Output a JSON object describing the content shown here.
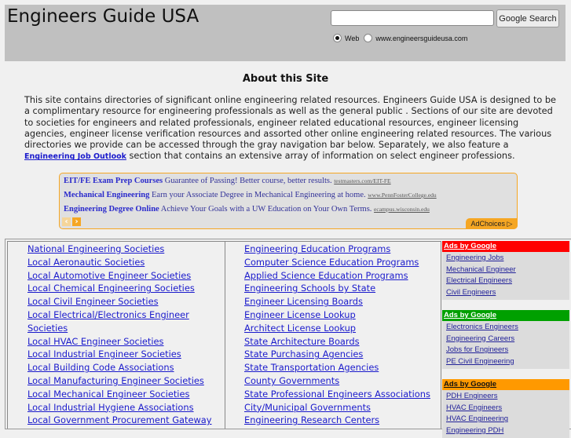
{
  "header": {
    "site_title": "Engineers Guide USA",
    "search": {
      "placeholder": "",
      "value": "",
      "button_label": "Google Search",
      "options": [
        {
          "label": "Web",
          "checked": true
        },
        {
          "label": "www.engineersguideusa.com",
          "checked": false
        }
      ]
    }
  },
  "about": {
    "title": "About this Site",
    "text_before_link": "This site contains directories of significant online engineering related resources.  Engineers Guide USA is designed to be a complimentary resource for engineering professionals as well as the general public .  Sections of our site are devoted to societies for engineers and related professionals, engineer related educational resources, engineer licensing agencies, engineer license verification resources and assorted other online engineering related resources.   The various directories we provide can be accessed through the gray navigation bar below.   Separately, we also feature a ",
    "link_label": "Engineering Job Outlook",
    "text_after_link": " section that contains an extensive array of information on select engineer professions."
  },
  "ad_banner": {
    "ads": [
      {
        "title": "EIT/FE Exam Prep Courses",
        "text": "Guarantee of Passing! Better course, better results.",
        "url": "testmasters.com/EIT-FE"
      },
      {
        "title": "Mechanical Engineering",
        "text": "Earn your Associate Degree in Mechanical Engineering at home.",
        "url": "www.PennFosterCollege.edu"
      },
      {
        "title": "Engineering Degree Online",
        "text": "Achieve Your Goals with a UW Education on Your Own Terms.",
        "url": "ecampus.wisconsin.edu"
      }
    ],
    "prev_icon": "‹",
    "next_icon": "›",
    "adchoices_label": "AdChoices ▷"
  },
  "directory": {
    "column1": [
      "National Engineering Societies ",
      "Local Aeronautic Societies",
      "Local Automotive Engineer Societies",
      "Local Chemical Engineering Societies",
      "Local Civil Engineer Societies",
      "Local Electrical/Electronics Engineer Societies",
      "Local HVAC Engineer Societies",
      "Local Industrial Engineer Societies",
      "Local Building Code Associations",
      "Local Manufacturing Engineer Societies",
      "Local Mechanical Engineer Societies",
      "Local Industrial Hygiene Associations",
      "Local Government Procurement Gateway"
    ],
    "column2": [
      "Engineering Education Programs",
      "Computer Science Education Programs",
      "Applied Science Education Programs",
      "Engineering Schools by State",
      "Engineer Licensing Boards",
      "Engineer License Lookup",
      "Architect License Lookup",
      "State Architecture Boards",
      "State Purchasing Agencies",
      "State Transportation Agencies",
      "County Governments",
      "State Professional Engineers Associations",
      "City/Municipal Governments",
      "Engineering Research Centers"
    ]
  },
  "side_ads": [
    {
      "heading": "Ads by Google",
      "color": "#ff0000",
      "text_color": "#ffffff",
      "links": [
        "Engineering Jobs",
        "Mechanical Engineer",
        "Electrical Engineers",
        "Civil Engineers"
      ]
    },
    {
      "heading": "Ads by Google",
      "color": "#00a000",
      "text_color": "#ffffff",
      "links": [
        "Electronics Engineers",
        "Engineering Careers",
        "Jobs for Engineers",
        "PE Civil Engineering"
      ]
    },
    {
      "heading": "Ads by Google",
      "color": "#ff9900",
      "text_color": "#111111",
      "links": [
        "PDH Engineers",
        "HVAC Engineers",
        "HVAC Engineering",
        "Engineering PDH"
      ]
    }
  ]
}
